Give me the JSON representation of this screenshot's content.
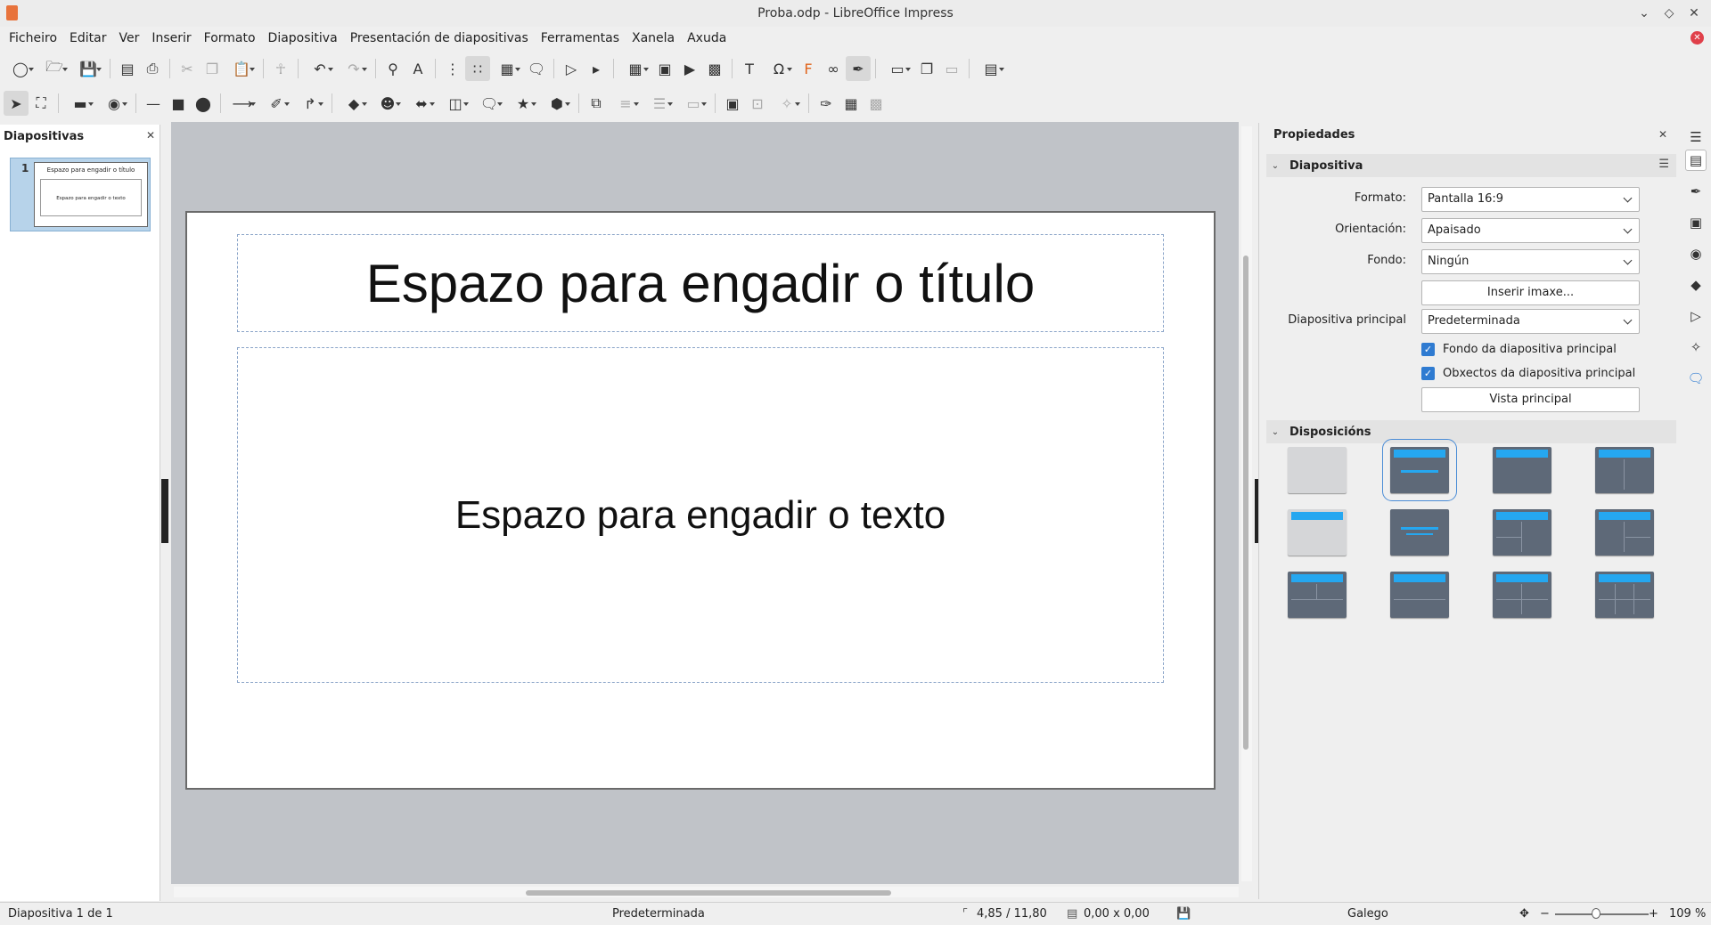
{
  "window": {
    "title": "Proba.odp - LibreOffice Impress"
  },
  "menu": [
    "Ficheiro",
    "Editar",
    "Ver",
    "Inserir",
    "Formato",
    "Diapositiva",
    "Presentación de diapositivas",
    "Ferramentas",
    "Xanela",
    "Axuda"
  ],
  "slides_pane": {
    "title": "Diapositivas",
    "thumb": {
      "number": "1",
      "title": "Espazo para engadir o título",
      "body": "Espazo para engadir o texto"
    }
  },
  "slide": {
    "title_placeholder": "Espazo para engadir o título",
    "body_placeholder": "Espazo para engadir o texto"
  },
  "properties": {
    "title": "Propiedades",
    "slide_section": {
      "label": "Diapositiva",
      "format": {
        "label": "Formato:",
        "value": "Pantalla 16:9"
      },
      "orientation": {
        "label": "Orientación:",
        "value": "Apaisado"
      },
      "background": {
        "label": "Fondo:",
        "value": "Ningún"
      },
      "insert_image": "Inserir imaxe...",
      "master_slide": {
        "label": "Diapositiva principal",
        "value": "Predeterminada"
      },
      "master_background": "Fondo da diapositiva principal",
      "master_objects": "Obxectos da diapositiva principal",
      "master_view": "Vista principal"
    },
    "layouts_section": {
      "label": "Disposicións"
    }
  },
  "status": {
    "slide_info": "Diapositiva 1 de 1",
    "master": "Predeterminada",
    "position": "4,85 / 11,80",
    "size": "0,00 x 0,00",
    "language": "Galego",
    "zoom": "109 %"
  }
}
